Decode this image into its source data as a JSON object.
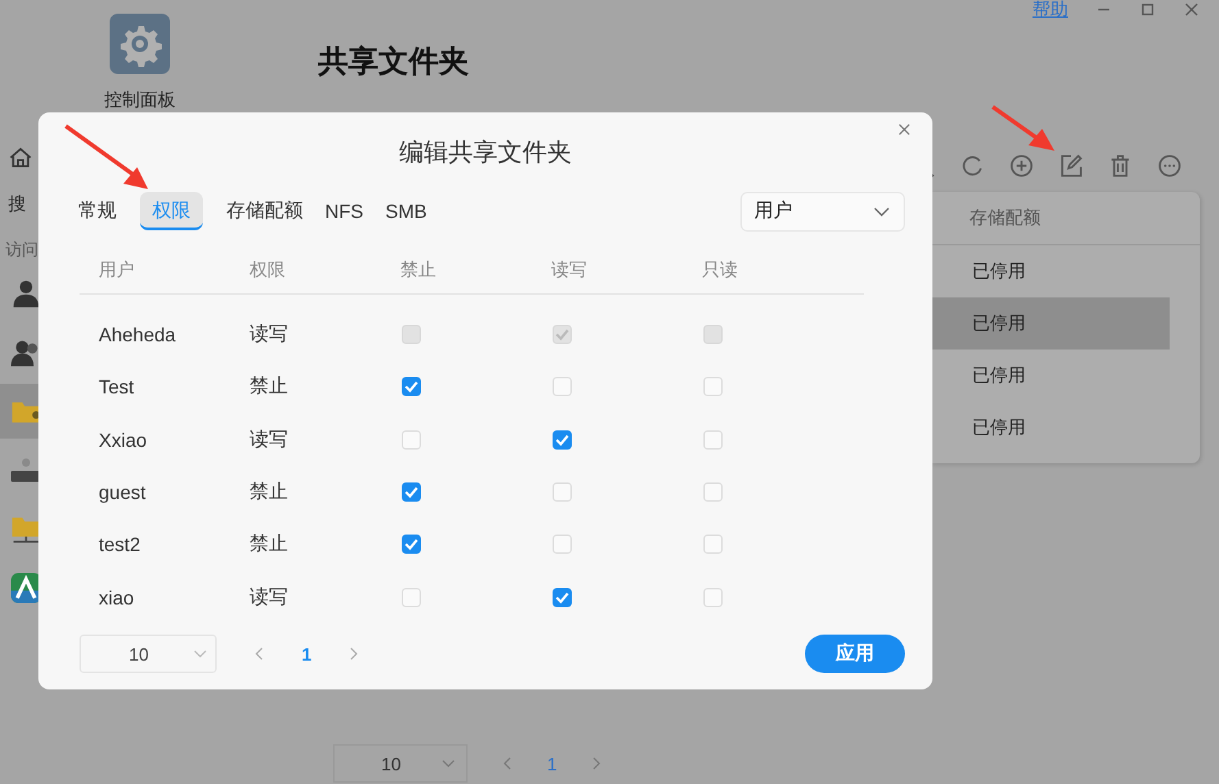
{
  "app": {
    "control_panel": {
      "label": "控制面板"
    },
    "title": "共享文件夹",
    "help_link": "帮助",
    "sidebar": {
      "search_text": "搜",
      "section_label": "访问",
      "items": [
        {
          "kind": "user",
          "selected": false
        },
        {
          "kind": "group",
          "selected": false
        },
        {
          "kind": "folder",
          "selected": true
        },
        {
          "kind": "ldap",
          "selected": false
        },
        {
          "kind": "network",
          "selected": false
        },
        {
          "kind": "app",
          "selected": false
        }
      ]
    },
    "table": {
      "column": "存储配额",
      "rows": [
        {
          "value": "已停用",
          "selected": false
        },
        {
          "value": "已停用",
          "selected": true
        },
        {
          "value": "已停用",
          "selected": false
        },
        {
          "value": "已停用",
          "selected": false
        }
      ]
    },
    "pagination": {
      "page_size": "10",
      "page": "1"
    }
  },
  "dialog": {
    "title": "编辑共享文件夹",
    "tabs": [
      {
        "label": "常规",
        "selected": false
      },
      {
        "label": "权限",
        "selected": true
      },
      {
        "label": "存储配额",
        "selected": false
      },
      {
        "label": "NFS",
        "selected": false
      },
      {
        "label": "SMB",
        "selected": false
      }
    ],
    "filter": "用户",
    "columns": [
      "用户",
      "权限",
      "禁止",
      "读写",
      "只读"
    ],
    "rows": [
      {
        "user": "Aheheda",
        "permission": "读写",
        "disabled": true,
        "deny": false,
        "read_write": true,
        "read_only": false
      },
      {
        "user": "Test",
        "permission": "禁止",
        "disabled": false,
        "deny": true,
        "read_write": false,
        "read_only": false
      },
      {
        "user": "Xxiao",
        "permission": "读写",
        "disabled": false,
        "deny": false,
        "read_write": true,
        "read_only": false
      },
      {
        "user": "guest",
        "permission": "禁止",
        "disabled": false,
        "deny": true,
        "read_write": false,
        "read_only": false
      },
      {
        "user": "test2",
        "permission": "禁止",
        "disabled": false,
        "deny": true,
        "read_write": false,
        "read_only": false
      },
      {
        "user": "xiao",
        "permission": "读写",
        "disabled": false,
        "deny": false,
        "read_write": true,
        "read_only": false
      }
    ],
    "pagination": {
      "page_size": "10",
      "page": "1"
    },
    "apply_button": "应用"
  }
}
